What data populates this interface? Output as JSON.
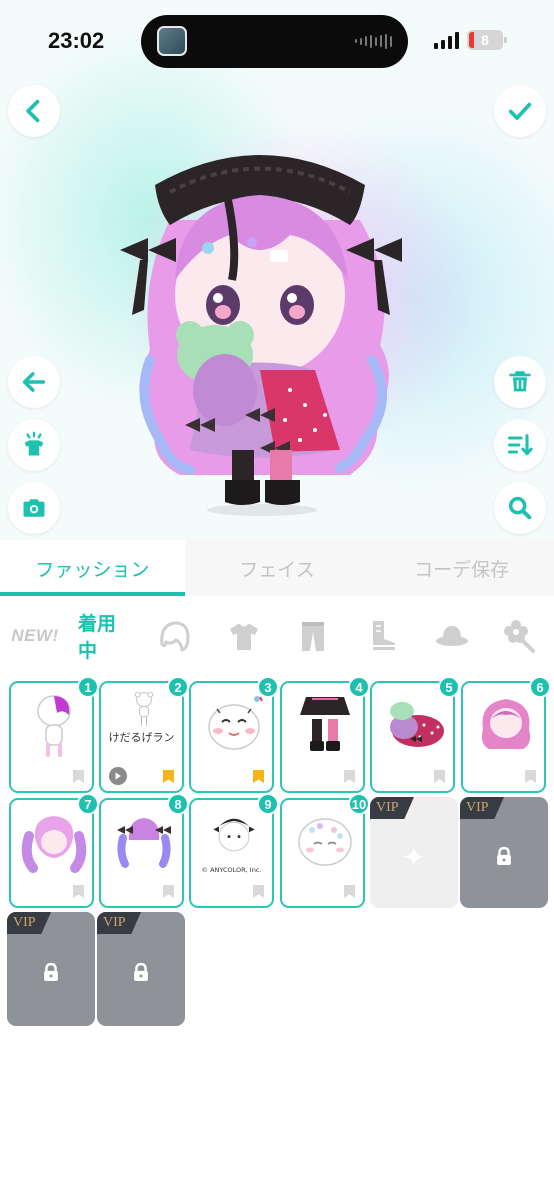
{
  "status_bar": {
    "time": "23:02",
    "battery": "8"
  },
  "tabs": [
    {
      "label": "ファッション",
      "active": true
    },
    {
      "label": "フェイス",
      "active": false
    },
    {
      "label": "コーデ保存",
      "active": false
    }
  ],
  "categories": {
    "new_label": "NEW!",
    "wearing_label": "着用中"
  },
  "items": [
    {
      "badge": "1"
    },
    {
      "badge": "2",
      "label": "けだるげラン"
    },
    {
      "badge": "3"
    },
    {
      "badge": "4"
    },
    {
      "badge": "5"
    },
    {
      "badge": "6"
    },
    {
      "badge": "7"
    },
    {
      "badge": "8"
    },
    {
      "badge": "9",
      "copyright": "© ANYCOLOR, Inc."
    },
    {
      "badge": "10"
    }
  ],
  "vip_label": "VIP",
  "colors": {
    "accent": "#1ec0b0",
    "bookmark_active": "#f5b614",
    "vip_locked": "#8f9399"
  }
}
